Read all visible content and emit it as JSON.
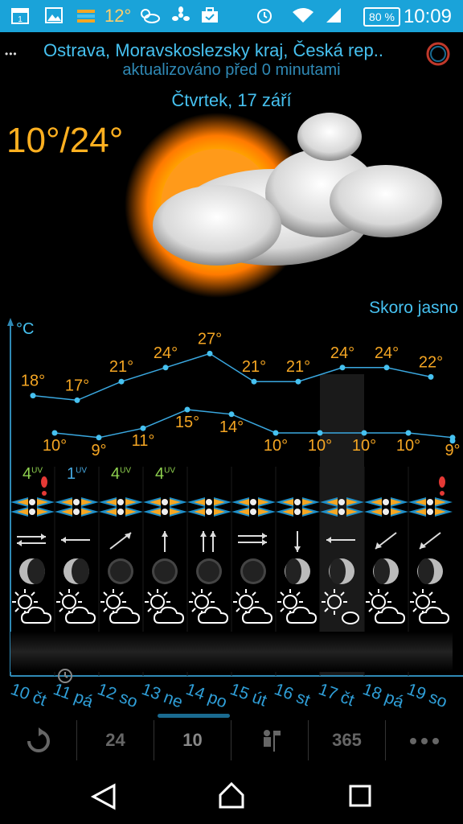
{
  "status_bar": {
    "temp": "12°",
    "battery": "80 %",
    "time": "10:09",
    "calendar_day": "1",
    "icons": [
      "calendar-icon",
      "gallery-icon",
      "weather-widget-icon",
      "weather-clouds-icon",
      "fan-icon",
      "briefcase-icon",
      "alarm-icon",
      "wifi-icon",
      "signal-icon",
      "battery-icon"
    ]
  },
  "header": {
    "dots": "•••",
    "location": "Ostrava, Moravskoslezsky kraj, Česká rep..",
    "updated": "aktualizováno před 0 minutami",
    "date": "Čtvrtek, 17 září"
  },
  "current": {
    "temp_range": "10°/24°",
    "condition": "Skoro jasno"
  },
  "chart_unit": "°C",
  "chart_data": {
    "type": "line",
    "categories": [
      "10 čt",
      "11 pá",
      "12 so",
      "13 ne",
      "14 po",
      "15 út",
      "16 st",
      "17 čt",
      "18 pá",
      "19 so"
    ],
    "series": [
      {
        "values": [
          18,
          17,
          21,
          24,
          27,
          21,
          21,
          24,
          24,
          22
        ]
      },
      {
        "values": [
          10,
          9,
          11,
          15,
          14,
          10,
          10,
          10,
          10,
          9
        ]
      }
    ],
    "ylabel": "°C"
  },
  "days": [
    {
      "label": "10 čt",
      "uv": "4",
      "uv_color": "green",
      "wind": "left-right",
      "moon": "waning",
      "weather": "sun-cloud"
    },
    {
      "label": "11 pá",
      "uv": "1",
      "uv_color": "blue",
      "wind": "left",
      "moon": "waning",
      "weather": "sun-cloud"
    },
    {
      "label": "12 so",
      "uv": "4",
      "uv_color": "green",
      "wind": "up-right",
      "moon": "new",
      "weather": "sun-cloud"
    },
    {
      "label": "13 ne",
      "uv": "4",
      "uv_color": "green",
      "wind": "up",
      "moon": "new",
      "weather": "sun-cloud"
    },
    {
      "label": "14 po",
      "uv": "",
      "uv_color": "green",
      "wind": "up-up",
      "moon": "new",
      "weather": "sun-cloud"
    },
    {
      "label": "15 út",
      "uv": "",
      "uv_color": "green",
      "wind": "right-right",
      "moon": "new",
      "weather": "sun-cloud"
    },
    {
      "label": "16 st",
      "uv": "",
      "uv_color": "green",
      "wind": "down",
      "moon": "waxing",
      "weather": "sun-cloud"
    },
    {
      "label": "17 čt",
      "uv": "",
      "uv_color": "green",
      "wind": "left",
      "moon": "waxing",
      "weather": "sun-small-cloud"
    },
    {
      "label": "18 pá",
      "uv": "",
      "uv_color": "green",
      "wind": "down-left",
      "moon": "waxing",
      "weather": "sun-cloud"
    },
    {
      "label": "19 so",
      "uv": "",
      "uv_color": "green",
      "wind": "down-left",
      "moon": "waxing",
      "weather": "sun-cloud"
    }
  ],
  "uv_sup": "UV",
  "toolbar": {
    "items": [
      "refresh-icon",
      "24",
      "10",
      "tourist-icon",
      "365",
      "more-icon"
    ]
  },
  "colors": {
    "accent": "#46c1f0",
    "temp": "#f5a623",
    "uv_green": "#8fd14f",
    "statusbar": "#1aa3d9"
  }
}
